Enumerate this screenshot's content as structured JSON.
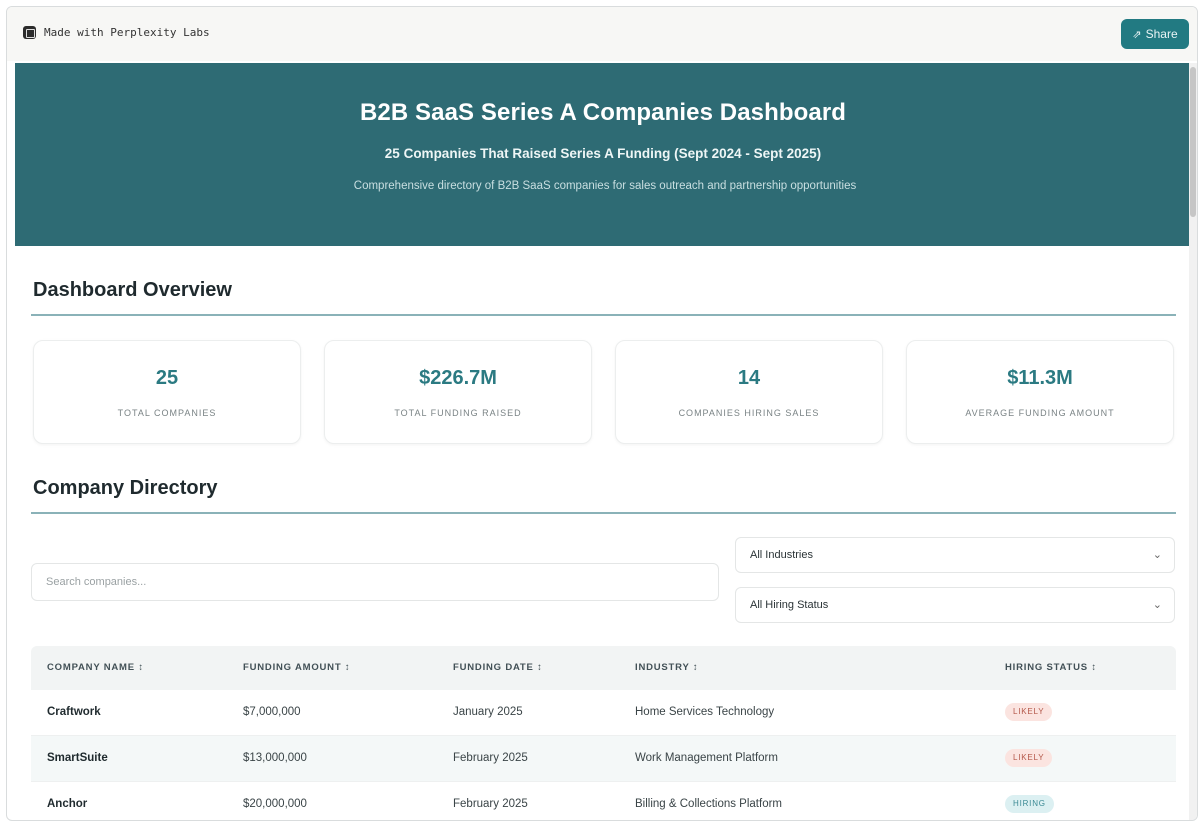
{
  "topbar": {
    "made_with": "Made with Perplexity Labs",
    "share_label": "Share"
  },
  "hero": {
    "title": "B2B SaaS Series A Companies Dashboard",
    "subtitle": "25 Companies That Raised Series A Funding (Sept 2024 - Sept 2025)",
    "description": "Comprehensive directory of B2B SaaS companies for sales outreach and partnership opportunities"
  },
  "overview": {
    "title": "Dashboard Overview",
    "stats": [
      {
        "value": "25",
        "label": "TOTAL COMPANIES"
      },
      {
        "value": "$226.7M",
        "label": "TOTAL FUNDING RAISED"
      },
      {
        "value": "14",
        "label": "COMPANIES HIRING SALES"
      },
      {
        "value": "$11.3M",
        "label": "AVERAGE FUNDING AMOUNT"
      }
    ]
  },
  "directory": {
    "title": "Company Directory",
    "search_placeholder": "Search companies...",
    "industry_filter": "All Industries",
    "hiring_filter": "All Hiring Status",
    "columns": [
      "COMPANY NAME ↕",
      "FUNDING AMOUNT ↕",
      "FUNDING DATE ↕",
      "INDUSTRY ↕",
      "HIRING STATUS ↕"
    ],
    "rows": [
      {
        "name": "Craftwork",
        "amount": "$7,000,000",
        "date": "January 2025",
        "industry": "Home Services Technology",
        "status": "LIKELY"
      },
      {
        "name": "SmartSuite",
        "amount": "$13,000,000",
        "date": "February 2025",
        "industry": "Work Management Platform",
        "status": "LIKELY"
      },
      {
        "name": "Anchor",
        "amount": "$20,000,000",
        "date": "February 2025",
        "industry": "Billing & Collections Platform",
        "status": "HIRING"
      }
    ]
  },
  "colors": {
    "accent": "#2e6b74",
    "share_button": "#227a82",
    "stat_value": "#2b7a82",
    "badge_likely": "#fbe4e0",
    "badge_hiring": "#dcf0f2"
  },
  "icons": {
    "brand": "perplexity-icon",
    "share": "share-icon",
    "select": "chevron-down-icon"
  }
}
